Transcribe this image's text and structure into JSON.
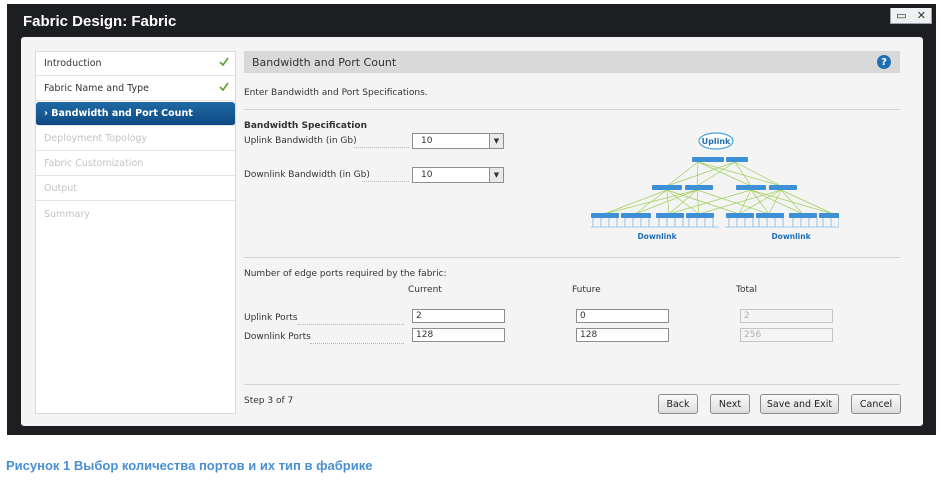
{
  "window": {
    "title": "Fabric Design: Fabric",
    "controls": {
      "minimize": "▭",
      "close": "✕"
    }
  },
  "nav": {
    "items": [
      {
        "label": "Introduction",
        "state": "done"
      },
      {
        "label": "Fabric Name and Type",
        "state": "done"
      },
      {
        "label": "› Bandwidth and Port Count",
        "state": "active"
      },
      {
        "label": "Deployment Topology",
        "state": "disabled"
      },
      {
        "label": "Fabric Customization",
        "state": "disabled"
      },
      {
        "label": "Output",
        "state": "disabled"
      },
      {
        "label": "Summary",
        "state": "disabled"
      }
    ]
  },
  "section": {
    "title": "Bandwidth and Port Count",
    "help_icon": "?",
    "intro": "Enter Bandwidth and Port Specifications."
  },
  "bandwidth": {
    "heading": "Bandwidth Specification",
    "uplink_label": "Uplink Bandwidth (in Gb)",
    "uplink_value": "10",
    "downlink_label": "Downlink Bandwidth (in Gb)",
    "downlink_value": "10"
  },
  "diagram": {
    "uplink_label": "Uplink",
    "downlink_left": "Downlink",
    "downlink_right": "Downlink"
  },
  "ports": {
    "heading": "Number of edge ports required by the fabric:",
    "columns": [
      "Current",
      "Future",
      "Total"
    ],
    "rows": [
      {
        "label": "Uplink Ports",
        "current": "2",
        "future": "0",
        "total": "2"
      },
      {
        "label": "Downlink Ports",
        "current": "128",
        "future": "128",
        "total": "256"
      }
    ]
  },
  "footer": {
    "step": "Step 3 of 7",
    "buttons": {
      "back": "Back",
      "next": "Next",
      "save_exit": "Save and Exit",
      "cancel": "Cancel"
    }
  },
  "caption": "Рисунок 1 Выбор количества портов и их тип в фабрике",
  "colors": {
    "title_bar": "#1c1e22",
    "active_nav": "#1463a0",
    "check": "#5aa02c",
    "accent_blue": "#1f6fb7",
    "caption": "#4a8fd0"
  }
}
